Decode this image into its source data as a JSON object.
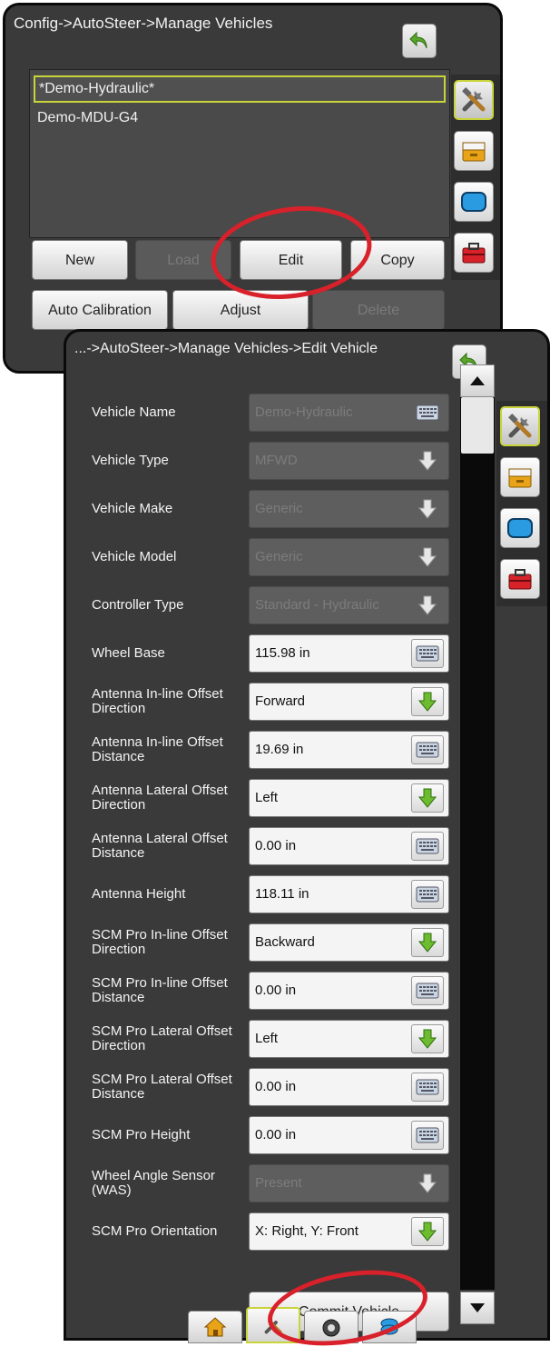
{
  "colors": {
    "panel_bg": "#3a3a3a",
    "accent_select": "#c8d43a",
    "highlight_oval": "#d8212b",
    "green_arrow": "#6dbb2e"
  },
  "manage_screen": {
    "breadcrumb": "Config->AutoSteer->Manage Vehicles",
    "vehicles": [
      "*Demo-Hydraulic*",
      "Demo-MDU-G4"
    ],
    "buttons": {
      "new": "New",
      "load": "Load",
      "edit": "Edit",
      "copy": "Copy",
      "auto_calibration": "Auto Calibration",
      "adjust": "Adjust",
      "delete": "Delete"
    }
  },
  "edit_screen": {
    "breadcrumb": "...->AutoSteer->Manage Vehicles->Edit Vehicle",
    "rows": [
      {
        "label": "Vehicle Name",
        "value": "Demo-Hydraulic",
        "control": "keyboard",
        "enabled": false
      },
      {
        "label": "Vehicle Type",
        "value": "MFWD",
        "control": "dropdown",
        "enabled": false
      },
      {
        "label": "Vehicle Make",
        "value": "Generic",
        "control": "dropdown",
        "enabled": false
      },
      {
        "label": "Vehicle Model",
        "value": "Generic",
        "control": "dropdown",
        "enabled": false
      },
      {
        "label": "Controller Type",
        "value": "Standard - Hydraulic",
        "control": "dropdown",
        "enabled": false
      },
      {
        "label": "Wheel Base",
        "value": "115.98 in",
        "control": "keyboard",
        "enabled": true
      },
      {
        "label": "Antenna In-line Offset Direction",
        "value": "Forward",
        "control": "dropdown",
        "enabled": true
      },
      {
        "label": "Antenna In-line Offset Distance",
        "value": "19.69 in",
        "control": "keyboard",
        "enabled": true
      },
      {
        "label": "Antenna Lateral Offset Direction",
        "value": "Left",
        "control": "dropdown",
        "enabled": true
      },
      {
        "label": "Antenna Lateral Offset Distance",
        "value": "0.00 in",
        "control": "keyboard",
        "enabled": true
      },
      {
        "label": "Antenna Height",
        "value": "118.11 in",
        "control": "keyboard",
        "enabled": true
      },
      {
        "label": "SCM Pro In-line Offset Direction",
        "value": "Backward",
        "control": "dropdown",
        "enabled": true
      },
      {
        "label": "SCM Pro In-line Offset Distance",
        "value": "0.00 in",
        "control": "keyboard",
        "enabled": true
      },
      {
        "label": "SCM Pro Lateral Offset Direction",
        "value": "Left",
        "control": "dropdown",
        "enabled": true
      },
      {
        "label": "SCM Pro Lateral Offset Distance",
        "value": "0.00 in",
        "control": "keyboard",
        "enabled": true
      },
      {
        "label": "SCM Pro Height",
        "value": "0.00 in",
        "control": "keyboard",
        "enabled": true
      },
      {
        "label": "Wheel Angle Sensor (WAS)",
        "value": "Present",
        "control": "dropdown",
        "enabled": false
      },
      {
        "label": "SCM Pro Orientation",
        "value": "X: Right, Y: Front",
        "control": "dropdown",
        "enabled": true
      }
    ],
    "commit_label": "Commit Vehicle"
  },
  "side_tabs": [
    "tools-icon",
    "drawer-icon",
    "console-icon",
    "toolbox-icon"
  ],
  "bottom_nav": [
    "home-icon",
    "tools-icon",
    "gauge-icon",
    "layers-icon"
  ]
}
